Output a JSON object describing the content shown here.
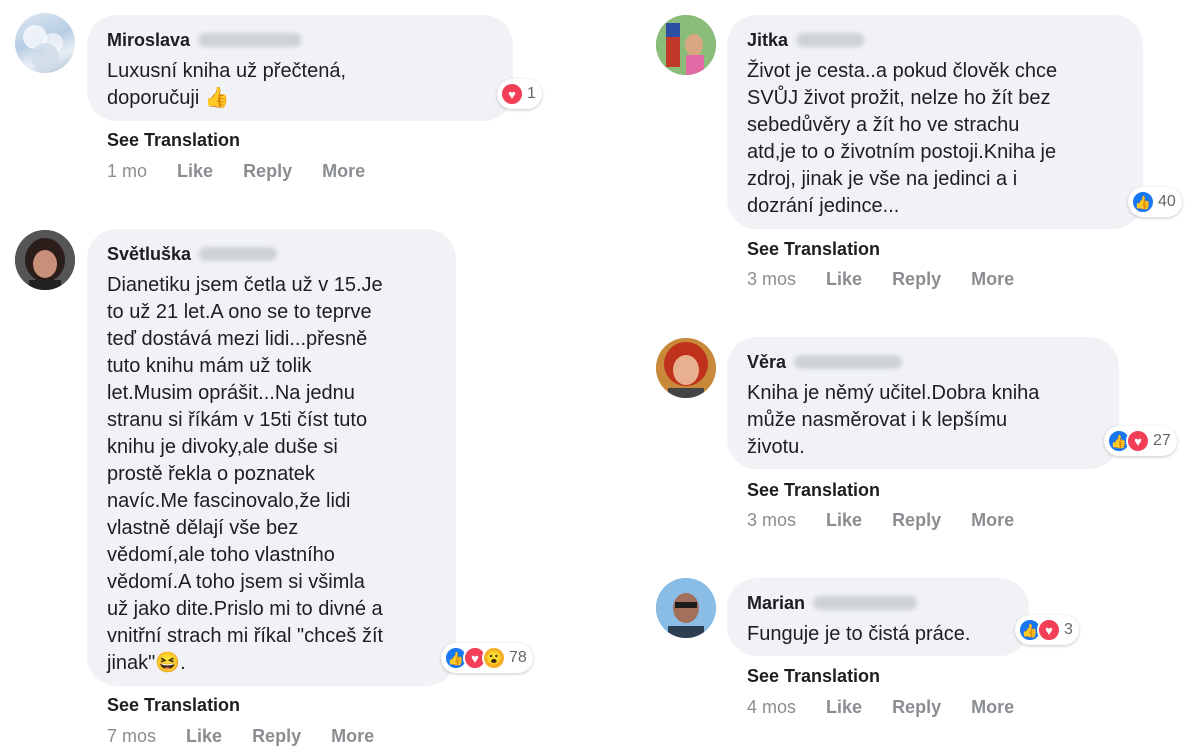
{
  "ui": {
    "see_translation": "See Translation",
    "like": "Like",
    "reply": "Reply",
    "more": "More"
  },
  "comments": [
    {
      "author": "Miroslava",
      "text": "Luxusní kniha už přečtená,\ndoporučuji 👍",
      "reaction_count": "1",
      "reactions": [
        "love"
      ],
      "time": "1 mo"
    },
    {
      "author": "Světluška",
      "text": "Dianetiku jsem četla už v 15.Je\nto už 21 let.A ono se to teprve\nteď dostává mezi lidi...přesně\ntuto knihu mám už tolik\nlet.Musim oprášit...Na jednu\nstranu si říkám v 15ti číst tuto\nknihu je divoky,ale duše si\nprostě řekla o poznatek\nnavíc.Me fascinovalo,že lidi\nvlastně dělají vše bez\nvědomí,ale toho vlastního\nvědomí.A toho jsem si všimla\nuž jako dite.Prislo mi to divné a\nvnitřní strach mi říkal \"chceš žít\njinak\"😆.",
      "reaction_count": "78",
      "reactions": [
        "like",
        "love",
        "wow"
      ],
      "time": "7 mos"
    },
    {
      "author": "Jitka",
      "text": "Život je cesta..a pokud člověk chce\nSVŮJ život prožit, nelze ho žít bez\nsebedůvěry a žít ho ve strachu\natd,je to o životním postoji.Kniha je\nzdroj, jinak je vše na jedinci a i\ndozrání jedince...",
      "reaction_count": "40",
      "reactions": [
        "like"
      ],
      "time": "3 mos"
    },
    {
      "author": "Věra",
      "text": "Kniha je němý učitel.Dobra kniha\nmůže nasměrovat i k lepšímu\nživotu.",
      "reaction_count": "27",
      "reactions": [
        "like",
        "love"
      ],
      "time": "3 mos"
    },
    {
      "author": "Marian",
      "text": "Funguje je to čistá práce.",
      "reaction_count": "3",
      "reactions": [
        "like",
        "love"
      ],
      "time": "4 mos"
    }
  ],
  "colors": {
    "bubble": "#f0f2f5",
    "like": "#1877f2",
    "love": "#f33e58",
    "wow": "#f7b125",
    "meta": "#8a8d91"
  }
}
